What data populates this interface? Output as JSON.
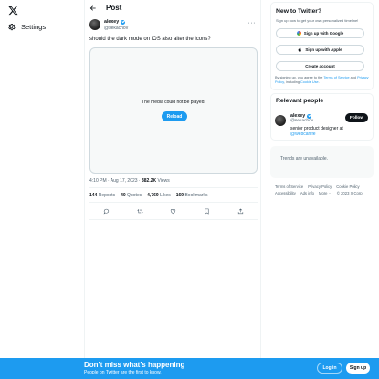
{
  "app": {
    "logo": "X",
    "logo_icon": "x-logo-icon"
  },
  "nav": {
    "settings_label": "Settings",
    "settings_icon": "gear-icon"
  },
  "header": {
    "title": "Post",
    "back_icon": "arrow-left-icon"
  },
  "tweet": {
    "author_name": "alexey",
    "author_handle": "@sekachov",
    "text": "should the dark mode on iOS also alter the icons?",
    "media_message": "The media could not be played.",
    "reload_label": "Reload",
    "time": "4:10 PM · Aug 17, 2023 · ",
    "views_count": "382.2K",
    "views_label": " Views",
    "reposts_count": "144",
    "reposts_label": " Reposts",
    "quotes_count": "40",
    "quotes_label": " Quotes",
    "likes_count": "4,769",
    "likes_label": " Likes",
    "bookmarks_count": "169",
    "bookmarks_label": " Bookmarks"
  },
  "signup": {
    "title": "New to Twitter?",
    "subtitle": "Sign up now to get your own personalized timeline!",
    "google_label": "Sign up with Google",
    "apple_label": "Sign up with Apple",
    "create_label": "Create account",
    "legal_prefix": "By signing up, you agree to the ",
    "terms": "Terms of Service",
    "and": " and ",
    "privacy": "Privacy Policy",
    "including": ", including ",
    "cookie": "Cookie Use",
    "period": "."
  },
  "relevant": {
    "title": "Relevant people",
    "name": "alexey",
    "handle": "@sekachov",
    "follow_label": "Follow",
    "bio": "senior product designer at",
    "bio_link": "@webcanife"
  },
  "trends": {
    "message": "Trends are unavailable."
  },
  "footer": {
    "line1": [
      "Terms of Service",
      "Privacy Policy",
      "Cookie Policy"
    ],
    "line2": [
      "Accessibility",
      "Ads info",
      "More ···",
      "© 2023 X Corp."
    ]
  },
  "banner": {
    "title": "Don’t miss what’s happening",
    "subtitle": "People on Twitter are the first to know.",
    "login_label": "Log in",
    "signup_label": "Sign up"
  },
  "colors": {
    "accent": "#1d9bf0",
    "text": "#0f1419",
    "muted": "#536471",
    "border": "#cfd9de"
  }
}
